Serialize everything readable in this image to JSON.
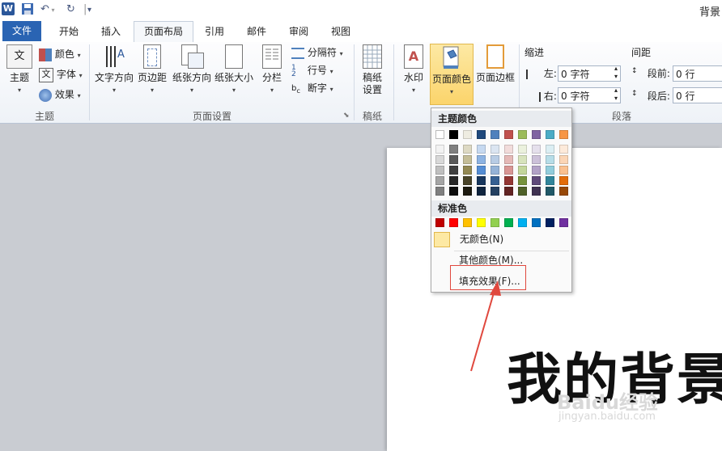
{
  "window": {
    "title": "背景"
  },
  "tabs": {
    "file": "文件",
    "items": [
      "开始",
      "插入",
      "页面布局",
      "引用",
      "邮件",
      "审阅",
      "视图"
    ]
  },
  "ribbon": {
    "theme_group": {
      "label": "主题",
      "theme_btn": "主题",
      "colors": "颜色",
      "fonts": "字体",
      "effects": "效果"
    },
    "page_setup": {
      "label": "页面设置",
      "text_direction": "文字方向",
      "margins": "页边距",
      "orientation": "纸张方向",
      "size": "纸张大小",
      "columns": "分栏",
      "breaks": "分隔符",
      "line_numbers": "行号",
      "hyphenation": "断字"
    },
    "manuscript": {
      "label": "稿纸",
      "btn_line1": "稿纸",
      "btn_line2": "设置"
    },
    "background": {
      "watermark": "水印",
      "page_color": "页面颜色",
      "page_borders": "页面边框"
    },
    "paragraph": {
      "label": "段落",
      "indent_title": "缩进",
      "spacing_title": "间距",
      "left_label": "左:",
      "left_value": "0 字符",
      "right_label": "右:",
      "right_value": "0 字符",
      "before_label": "段前:",
      "before_value": "0 行",
      "after_label": "段后:",
      "after_value": "0 行"
    }
  },
  "menu": {
    "theme_colors_title": "主题颜色",
    "standard_colors_title": "标准色",
    "theme_colors": [
      "#ffffff",
      "#000000",
      "#eeece1",
      "#1f497d",
      "#4f81bd",
      "#c0504d",
      "#9bbb59",
      "#8064a2",
      "#4bacc6",
      "#f79646"
    ],
    "theme_shades": [
      [
        "#f2f2f2",
        "#7f7f7f",
        "#ddd9c3",
        "#c6d9f0",
        "#dbe5f1",
        "#f2dcdb",
        "#ebf1dd",
        "#e5e0ec",
        "#dbeef3",
        "#fdeada"
      ],
      [
        "#d8d8d8",
        "#595959",
        "#c4bd97",
        "#8db3e2",
        "#b8cce4",
        "#e5b9b7",
        "#d7e3bc",
        "#ccc1d9",
        "#b7dde8",
        "#fbd5b5"
      ],
      [
        "#bfbfbf",
        "#3f3f3f",
        "#938953",
        "#548dd4",
        "#95b3d7",
        "#d99694",
        "#c3d69b",
        "#b2a2c7",
        "#92cddc",
        "#fac08f"
      ],
      [
        "#a5a5a5",
        "#262626",
        "#494429",
        "#17365d",
        "#366092",
        "#953734",
        "#76923c",
        "#5f497a",
        "#31859b",
        "#e36c09"
      ],
      [
        "#7f7f7f",
        "#0c0c0c",
        "#1d1b10",
        "#0f243e",
        "#244061",
        "#632423",
        "#4f6128",
        "#3f3151",
        "#205867",
        "#974806"
      ]
    ],
    "standard_colors": [
      "#c00000",
      "#ff0000",
      "#ffc000",
      "#ffff00",
      "#92d050",
      "#00b050",
      "#00b0f0",
      "#0070c0",
      "#002060",
      "#7030a0"
    ],
    "no_color": "无颜色(N)",
    "more_colors": "其他颜色(M)...",
    "fill_effects": "填充效果(F)..."
  },
  "document": {
    "text": "我的背景"
  },
  "watermark_logo": {
    "brand": "Baidu经验",
    "url": "jingyan.baidu.com"
  },
  "annotation_color": "#e0483e"
}
